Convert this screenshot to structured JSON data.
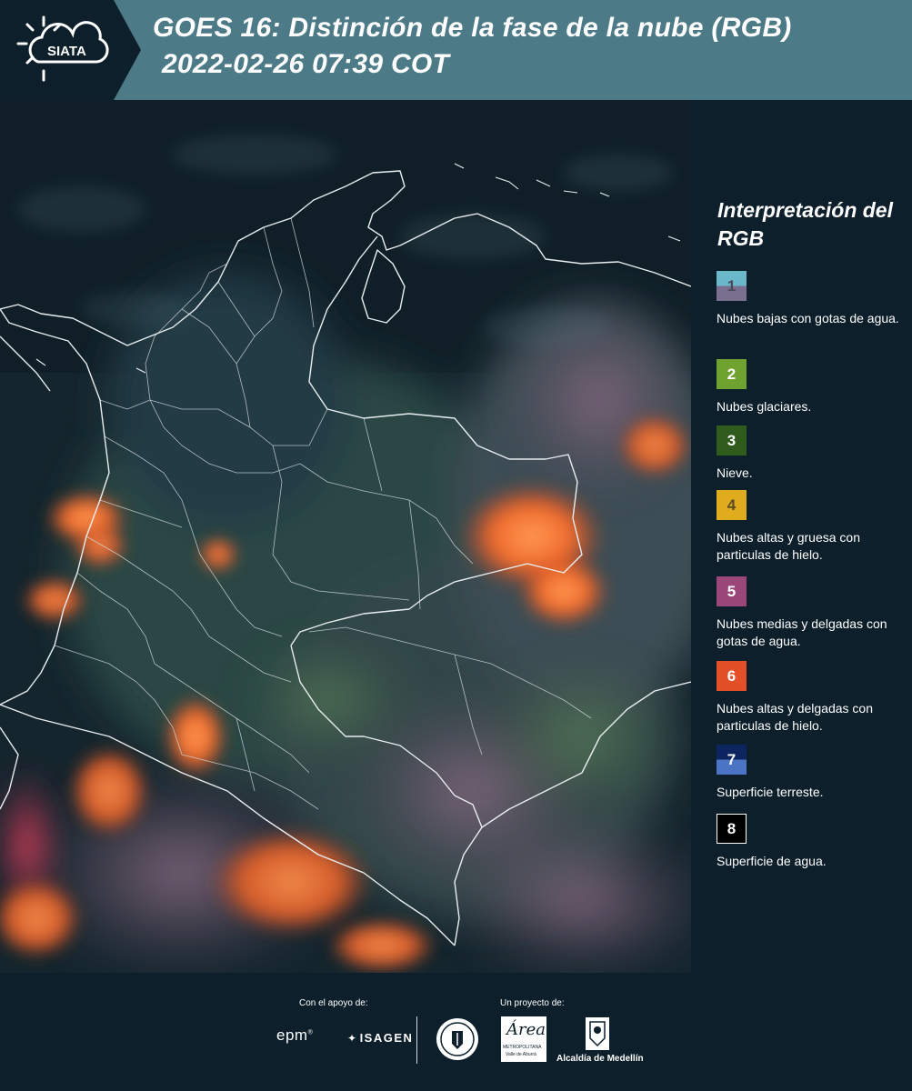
{
  "header": {
    "logo_text": "SIATA",
    "title_line1": "GOES 16: Distinción de la fase de la nube (RGB)",
    "title_line2": "2022-02-26 07:39 COT"
  },
  "legend": {
    "title": "Interpretación del RGB",
    "items": [
      {
        "number": "1",
        "label": "Nubes bajas con gotas de agua.",
        "color_top": "#6ab8c9",
        "color_bottom": "#7a6f8e"
      },
      {
        "number": "2",
        "label": "Nubes glaciares.",
        "color_top": "#6fa22e",
        "color_bottom": "#6fa22e"
      },
      {
        "number": "3",
        "label": "Nieve.",
        "color_top": "#2f5b1c",
        "color_bottom": "#2f5b1c"
      },
      {
        "number": "4",
        "label": "Nubes altas y gruesa con particulas de hielo.",
        "color_top": "#e1ab1e",
        "color_bottom": "#e1ab1e"
      },
      {
        "number": "5",
        "label": "Nubes medias y delgadas con gotas de agua.",
        "color_top": "#9a4679",
        "color_bottom": "#9a4679"
      },
      {
        "number": "6",
        "label": "Nubes altas y delgadas con particulas de hielo.",
        "color_top": "#e34f27",
        "color_bottom": "#e34f27"
      },
      {
        "number": "7",
        "label": "Superficie terreste.",
        "color_top": "#0c2460",
        "color_bottom": "#4c74c4"
      },
      {
        "number": "8",
        "label": "Superficie de agua.",
        "color_top": "#000000",
        "color_bottom": "#000000"
      }
    ]
  },
  "footer": {
    "support_label": "Con el apoyo de:",
    "project_label": "Un proyecto de:",
    "sponsor_1": "epm",
    "sponsor_2": "ISAGEN",
    "area_logo_text": "Área",
    "area_logo_sub": "METROPOLITANA",
    "area_logo_sub2": "Valle de Aburrá",
    "alcaldia": "Alcaldía de Medellín"
  }
}
